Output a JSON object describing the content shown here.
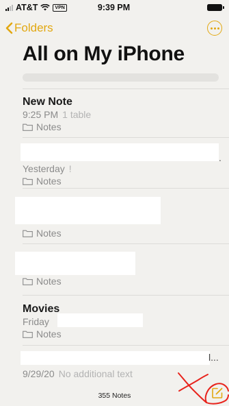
{
  "status_bar": {
    "carrier": "AT&T",
    "vpn": "VPN",
    "time": "9:39 PM"
  },
  "nav": {
    "back_label": "Folders"
  },
  "page_title": "All on My iPhone",
  "notes": [
    {
      "title": "New Note",
      "time": "9:25 PM",
      "extra": "1 table",
      "folder": "Notes"
    },
    {
      "title": "",
      "time": "Yesterday",
      "extra": "!",
      "folder": "Notes"
    },
    {
      "title": "",
      "time": "",
      "extra": "",
      "folder": "Notes"
    },
    {
      "title": "",
      "time": "",
      "extra": "",
      "folder": "Notes"
    },
    {
      "title": "Movies",
      "time": "Friday",
      "extra": "",
      "folder": "Notes"
    },
    {
      "title": "",
      "time": "9/29/20",
      "extra": "No additional text",
      "folder": ""
    }
  ],
  "footer": {
    "count_label": "355 Notes"
  },
  "colors": {
    "accent": "#e2a811",
    "annotation": "#e8231c"
  }
}
